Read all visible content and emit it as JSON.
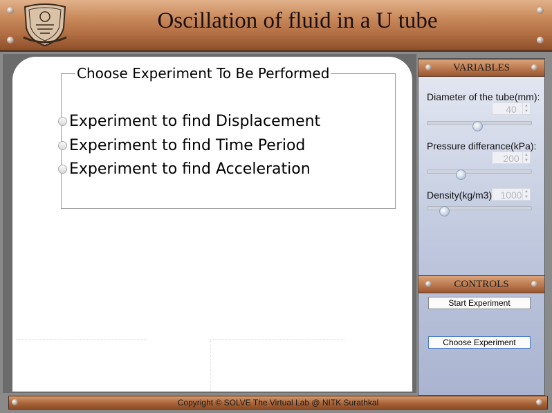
{
  "header": {
    "title": "Oscillation of fluid in a U tube",
    "logo_icon": "nitk-emblem-icon"
  },
  "experiment_chooser": {
    "legend": "Choose Experiment To Be Performed",
    "options": [
      {
        "label": "Experiment to find Displacement",
        "selected": false
      },
      {
        "label": "Experiment to find Time Period",
        "selected": false
      },
      {
        "label": "Experiment to find Acceleration",
        "selected": false
      }
    ]
  },
  "variables": {
    "title": "VARIABLES",
    "items": [
      {
        "label": "Diameter of the tube(mm):",
        "value": "40",
        "slider_fraction": 0.48
      },
      {
        "label": "Pressure differance(kPa):",
        "value": "200",
        "slider_fraction": 0.32
      },
      {
        "label": "Density(kg/m3):",
        "value": "1000",
        "slider_fraction": 0.15
      }
    ]
  },
  "controls": {
    "title": "CONTROLS",
    "start_label": "Start Experiment",
    "choose_label": "Choose Experiment"
  },
  "footer": {
    "text": "Copyright © SOLVE The Virtual Lab @ NITK Surathkal"
  },
  "colors": {
    "copper": "#b06d42",
    "panel_blue": "#aab4d0"
  }
}
